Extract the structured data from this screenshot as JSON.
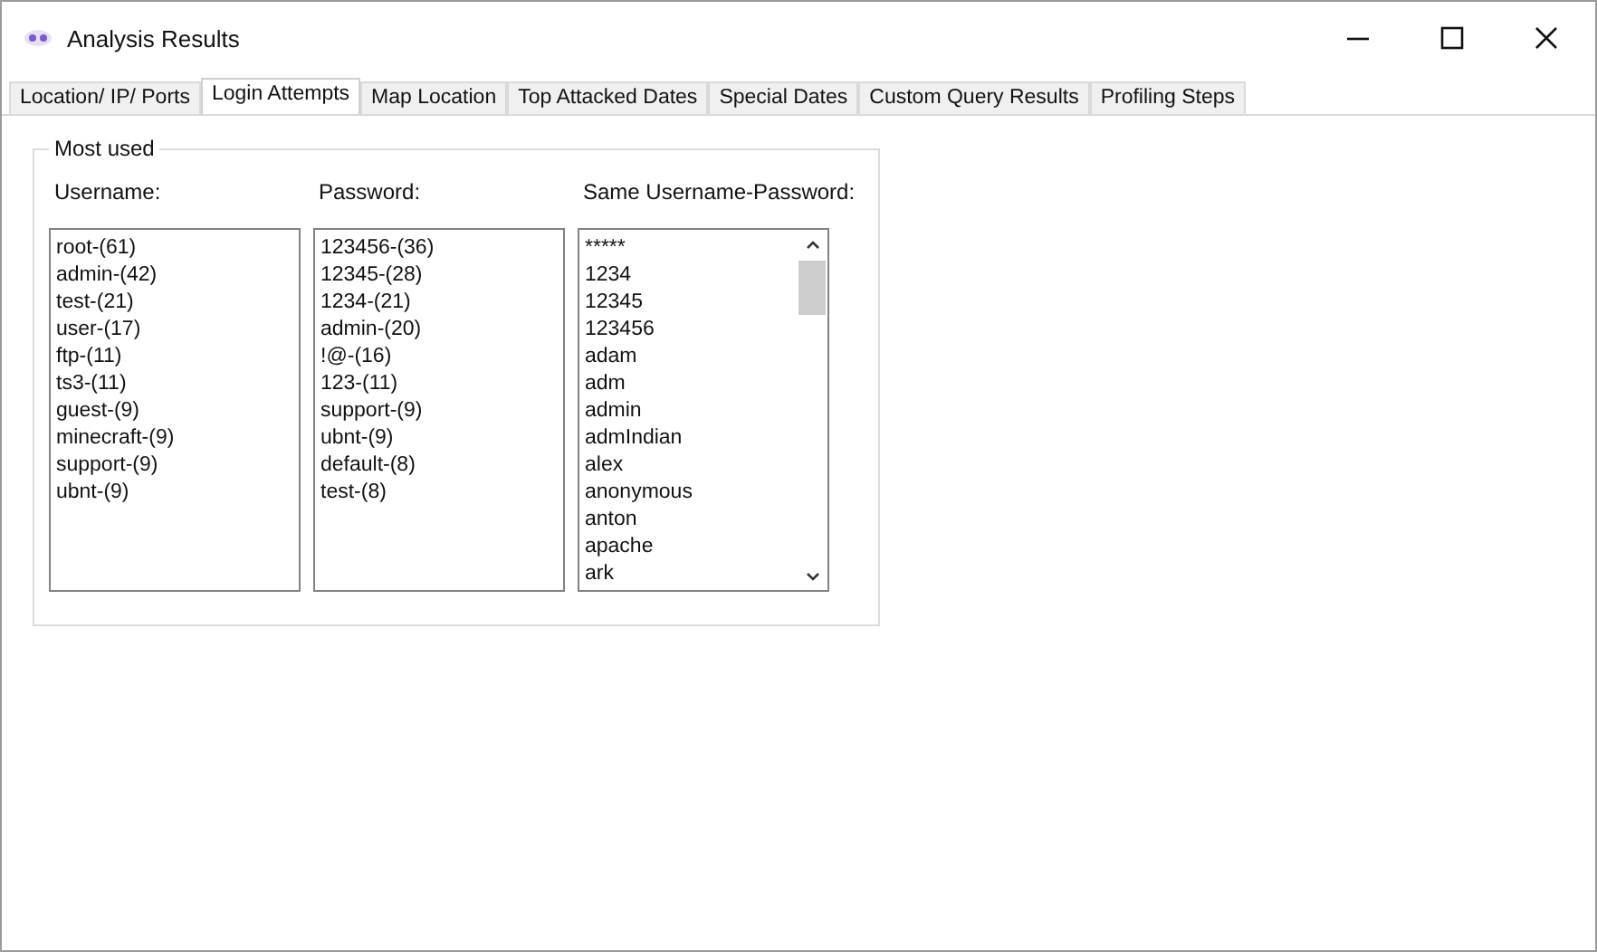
{
  "window": {
    "title": "Analysis Results"
  },
  "tabs": [
    {
      "label": "Location/ IP/ Ports",
      "selected": false
    },
    {
      "label": "Login Attempts",
      "selected": true
    },
    {
      "label": "Map Location",
      "selected": false
    },
    {
      "label": "Top Attacked Dates",
      "selected": false
    },
    {
      "label": "Special Dates",
      "selected": false
    },
    {
      "label": "Custom Query Results",
      "selected": false
    },
    {
      "label": "Profiling Steps",
      "selected": false
    }
  ],
  "group": {
    "title": "Most used",
    "lists": [
      {
        "label": "Username:",
        "scrollable": false,
        "items": [
          "root-(61)",
          "admin-(42)",
          "test-(21)",
          "user-(17)",
          "ftp-(11)",
          "ts3-(11)",
          "guest-(9)",
          "minecraft-(9)",
          "support-(9)",
          "ubnt-(9)"
        ]
      },
      {
        "label": "Password:",
        "scrollable": false,
        "items": [
          "123456-(36)",
          "12345-(28)",
          "1234-(21)",
          "admin-(20)",
          "!@-(16)",
          "123-(11)",
          "support-(9)",
          "ubnt-(9)",
          "default-(8)",
          "test-(8)"
        ]
      },
      {
        "label": "Same Username-Password:",
        "scrollable": true,
        "items": [
          "*****",
          "1234",
          "12345",
          "123456",
          "adam",
          "adm",
          "admin",
          "admIndian",
          "alex",
          "anonymous",
          "anton",
          "apache",
          "ark"
        ]
      }
    ]
  }
}
